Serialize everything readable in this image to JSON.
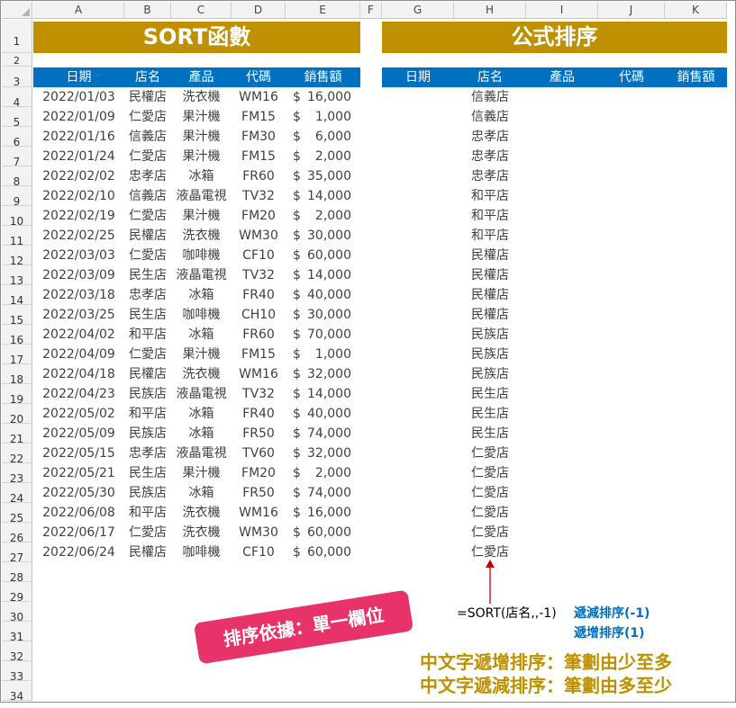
{
  "columns": [
    "A",
    "B",
    "C",
    "D",
    "E",
    "F",
    "G",
    "H",
    "I",
    "J",
    "K"
  ],
  "rows": [
    "1",
    "2",
    "3",
    "4",
    "5",
    "6",
    "7",
    "8",
    "9",
    "10",
    "11",
    "12",
    "13",
    "14",
    "15",
    "16",
    "17",
    "18",
    "19",
    "20",
    "21",
    "22",
    "23",
    "24",
    "25",
    "26",
    "27",
    "28",
    "29",
    "30",
    "31",
    "32",
    "33",
    "34"
  ],
  "left_title": "SORT函數",
  "right_title": "公式排序",
  "headers": [
    "日期",
    "店名",
    "產品",
    "代碼",
    "銷售額"
  ],
  "data_rows": [
    {
      "date": "2022/01/03",
      "store": "民權店",
      "product": "洗衣機",
      "code": "WM16",
      "amount": "16,000"
    },
    {
      "date": "2022/01/09",
      "store": "仁愛店",
      "product": "果汁機",
      "code": "FM15",
      "amount": "1,000"
    },
    {
      "date": "2022/01/16",
      "store": "信義店",
      "product": "果汁機",
      "code": "FM30",
      "amount": "6,000"
    },
    {
      "date": "2022/01/24",
      "store": "仁愛店",
      "product": "果汁機",
      "code": "FM15",
      "amount": "2,000"
    },
    {
      "date": "2022/02/02",
      "store": "忠孝店",
      "product": "冰箱",
      "code": "FR60",
      "amount": "35,000"
    },
    {
      "date": "2022/02/10",
      "store": "信義店",
      "product": "液晶電視",
      "code": "TV32",
      "amount": "14,000"
    },
    {
      "date": "2022/02/19",
      "store": "仁愛店",
      "product": "果汁機",
      "code": "FM20",
      "amount": "2,000"
    },
    {
      "date": "2022/02/25",
      "store": "民權店",
      "product": "洗衣機",
      "code": "WM30",
      "amount": "30,000"
    },
    {
      "date": "2022/03/03",
      "store": "仁愛店",
      "product": "咖啡機",
      "code": "CF10",
      "amount": "60,000"
    },
    {
      "date": "2022/03/09",
      "store": "民生店",
      "product": "液晶電視",
      "code": "TV32",
      "amount": "14,000"
    },
    {
      "date": "2022/03/18",
      "store": "忠孝店",
      "product": "冰箱",
      "code": "FR40",
      "amount": "40,000"
    },
    {
      "date": "2022/03/25",
      "store": "民生店",
      "product": "咖啡機",
      "code": "CH10",
      "amount": "30,000"
    },
    {
      "date": "2022/04/02",
      "store": "和平店",
      "product": "冰箱",
      "code": "FR60",
      "amount": "70,000"
    },
    {
      "date": "2022/04/09",
      "store": "仁愛店",
      "product": "果汁機",
      "code": "FM15",
      "amount": "1,000"
    },
    {
      "date": "2022/04/18",
      "store": "民權店",
      "product": "洗衣機",
      "code": "WM16",
      "amount": "32,000"
    },
    {
      "date": "2022/04/23",
      "store": "民族店",
      "product": "液晶電視",
      "code": "TV32",
      "amount": "14,000"
    },
    {
      "date": "2022/05/02",
      "store": "和平店",
      "product": "冰箱",
      "code": "FR40",
      "amount": "40,000"
    },
    {
      "date": "2022/05/09",
      "store": "民族店",
      "product": "冰箱",
      "code": "FR50",
      "amount": "74,000"
    },
    {
      "date": "2022/05/15",
      "store": "忠孝店",
      "product": "液晶電視",
      "code": "TV60",
      "amount": "32,000"
    },
    {
      "date": "2022/05/21",
      "store": "民生店",
      "product": "果汁機",
      "code": "FM20",
      "amount": "2,000"
    },
    {
      "date": "2022/05/30",
      "store": "民族店",
      "product": "冰箱",
      "code": "FR50",
      "amount": "74,000"
    },
    {
      "date": "2022/06/08",
      "store": "和平店",
      "product": "洗衣機",
      "code": "WM16",
      "amount": "16,000"
    },
    {
      "date": "2022/06/17",
      "store": "仁愛店",
      "product": "洗衣機",
      "code": "WM30",
      "amount": "60,000"
    },
    {
      "date": "2022/06/24",
      "store": "民權店",
      "product": "咖啡機",
      "code": "CF10",
      "amount": "60,000"
    }
  ],
  "currency": "$",
  "sorted_stores": [
    "信義店",
    "信義店",
    "忠孝店",
    "忠孝店",
    "忠孝店",
    "和平店",
    "和平店",
    "和平店",
    "民權店",
    "民權店",
    "民權店",
    "民權店",
    "民族店",
    "民族店",
    "民族店",
    "民生店",
    "民生店",
    "民生店",
    "仁愛店",
    "仁愛店",
    "仁愛店",
    "仁愛店",
    "仁愛店",
    "仁愛店"
  ],
  "formula": "=SORT(店名,,-1)",
  "note_desc": "遞減排序(-1)",
  "note_asc": "遞增排序(1)",
  "stamp": "排序依據：單一欄位",
  "note_cn_asc": "中文字遞增排序：筆劃由少至多",
  "note_cn_desc": "中文字遞減排序：筆劃由多至少",
  "colors": {
    "gold": "#bf9000",
    "blue": "#0070c0",
    "pink": "#e8326a",
    "arrow": "#c00000"
  }
}
